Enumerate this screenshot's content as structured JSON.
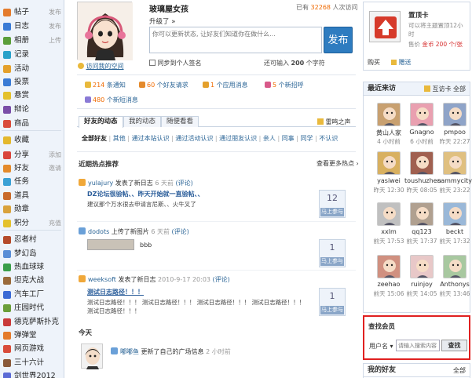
{
  "nav": {
    "items": [
      {
        "label": "帖子",
        "extra": "发布",
        "color": "#e47b2c"
      },
      {
        "label": "日志",
        "extra": "发布",
        "color": "#3a7bd5"
      },
      {
        "label": "相册",
        "extra": "上传",
        "color": "#5a9e3a"
      },
      {
        "label": "记录",
        "extra": "",
        "color": "#2aa1c9"
      },
      {
        "label": "活动",
        "extra": "",
        "color": "#e4a02c"
      },
      {
        "label": "投票",
        "extra": "",
        "color": "#3a7bd5"
      },
      {
        "label": "悬赏",
        "extra": "",
        "color": "#e4c12c"
      },
      {
        "label": "辩论",
        "extra": "",
        "color": "#7a4ea8"
      },
      {
        "label": "商品",
        "extra": "",
        "color": "#d94c3b"
      },
      {
        "label": "收藏",
        "extra": "",
        "color": "#e4b82c"
      },
      {
        "label": "分享",
        "extra": "添加",
        "color": "#d9453b"
      },
      {
        "label": "好友",
        "extra": "邀请",
        "color": "#e48a2c"
      },
      {
        "label": "任务",
        "extra": "",
        "color": "#3aa0d5"
      },
      {
        "label": "道具",
        "extra": "",
        "color": "#c96a2a"
      },
      {
        "label": "勋章",
        "extra": "",
        "color": "#d9a23b"
      },
      {
        "label": "积分",
        "extra": "充值",
        "color": "#e4c12c"
      },
      {
        "label": "忍者村",
        "extra": "",
        "color": "#b54a2a"
      },
      {
        "label": "梦幻岛",
        "extra": "",
        "color": "#5a8ed6"
      },
      {
        "label": "热血球球",
        "extra": "",
        "color": "#3a9e4a"
      },
      {
        "label": "坦克大战",
        "extra": "",
        "color": "#9a6a3a"
      },
      {
        "label": "汽车工厂",
        "extra": "",
        "color": "#3a6ad5"
      },
      {
        "label": "庄园时代",
        "extra": "",
        "color": "#6a9e3a"
      },
      {
        "label": "德克萨斯扑克",
        "extra": "",
        "color": "#c93a3a"
      },
      {
        "label": "弹弹堂",
        "extra": "",
        "color": "#e47b2c"
      },
      {
        "label": "网页游戏",
        "extra": "",
        "color": "#d94c3b"
      },
      {
        "label": "三十六计",
        "extra": "",
        "color": "#8a5a3a"
      },
      {
        "label": "剑世界2012",
        "extra": "",
        "color": "#5a6ad5"
      }
    ]
  },
  "profile": {
    "name": "玻璃屋女孩",
    "visits_prefix": "已有",
    "visits": "32268",
    "visits_suffix": "人次访问",
    "upgrade": "升级了 »",
    "status_placeholder": "你可以更新状态, 让好友们知道你在做什么...",
    "publish": "发布",
    "sync_label": "同步到个人签名",
    "remaining_prefix": "还可输入",
    "remaining": "200",
    "remaining_suffix": "个字符",
    "visit_space": "访问我的空间"
  },
  "notices": [
    {
      "num": "214",
      "text": "条通知"
    },
    {
      "num": "60",
      "text": "个好友请求"
    },
    {
      "num": "1",
      "text": "个应用消息"
    },
    {
      "num": "5",
      "text": "个新招呼"
    },
    {
      "num": "480",
      "text": "个新短消息"
    }
  ],
  "tabs": [
    "好友的动态",
    "我的动态",
    "随便看看"
  ],
  "thunder": "雷鸣之声",
  "filters": [
    "全部好友",
    "其他",
    "通过本站认识",
    "通过活动认识",
    "通过朋友认识",
    "亲人",
    "同事",
    "同学",
    "不认识"
  ],
  "hot": {
    "title": "近期热点推荐",
    "more": "查看更多热点 ›"
  },
  "feeds": [
    {
      "user": "yulajury",
      "action": "发表了新日志",
      "time": "6 天前",
      "comment": "(评论)",
      "title": "DZ论坛很验帖、、昨天开始就一直验帖、、",
      "body": "建议那个万水很去申请言尼斯、、火牛叉了",
      "votes": "12",
      "vote_label": "马上参与"
    },
    {
      "user": "dodots",
      "action": "上传了新图片",
      "time": "6 天前",
      "comment": "(评论)",
      "caption": "bbb",
      "votes": "1",
      "vote_label": "马上参与"
    },
    {
      "user": "weeksoft",
      "action": "发表了新日志",
      "time": "2010-9-17 20:03",
      "comment": "(评论)",
      "title": "测试日志路径！！！",
      "body": "测试日志路径！！！ 测试日志路径！！！ 测试日志路径！！！ 测试日志路径！！！",
      "body2": "测试日志路径！！！",
      "votes": "1",
      "vote_label": "马上参与"
    }
  ],
  "today": {
    "title": "今天",
    "user": "嘟嘟鱼",
    "action": "更新了自己的广场信息",
    "time": "2 小时前"
  },
  "card": {
    "title": "置顶卡",
    "desc": "可以将主题置顶12小时",
    "price_label": "售价",
    "price": "金币 200 个/张",
    "buy": "购买",
    "gift": "赠送"
  },
  "visitors": {
    "title": "最近来访",
    "link1": "互访卡",
    "link2": "全部",
    "people": [
      {
        "name": "黄山人家",
        "time": "4 小时前"
      },
      {
        "name": "Gnagno",
        "time": "6 小时前"
      },
      {
        "name": "pmpoo",
        "time": "昨天 22:27"
      },
      {
        "name": "yasiwei",
        "time": "昨天 12:30"
      },
      {
        "name": "toushuzhen",
        "time": "昨天 08:05"
      },
      {
        "name": "sammycity",
        "time": "前天 23:22"
      },
      {
        "name": "xxlm",
        "time": "前天 17:53"
      },
      {
        "name": "qq123",
        "time": "前天 17:37"
      },
      {
        "name": "beckt",
        "time": "前天 17:32"
      },
      {
        "name": "zeehao",
        "time": "前天 15:06"
      },
      {
        "name": "ruinjoy",
        "time": "前天 14:05"
      },
      {
        "name": "Anthonys",
        "time": "前天 13:46"
      }
    ]
  },
  "finder": {
    "title": "查找会员",
    "label": "用户名",
    "placeholder": "请输入搜索内容",
    "button": "查找"
  },
  "friends": {
    "title": "我的好友",
    "all": "全部"
  },
  "colors": {
    "accent": "#2e7cc0",
    "border_red": "#e02020",
    "orange": "#f06a00"
  }
}
